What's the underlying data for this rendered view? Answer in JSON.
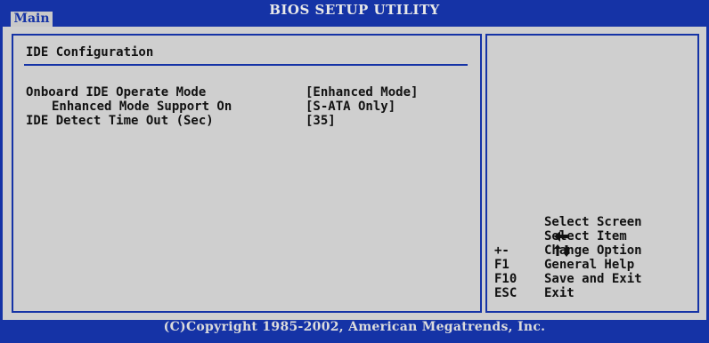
{
  "header": {
    "title": "BIOS SETUP UTILITY",
    "active_tab": "Main"
  },
  "section": {
    "title": "IDE Configuration"
  },
  "settings": [
    {
      "label": "Onboard IDE Operate Mode",
      "value": "[Enhanced Mode]"
    },
    {
      "label": "Enhanced Mode Support On",
      "value": "[S-ATA Only]"
    },
    {
      "label": "IDE Detect Time Out (Sec)",
      "value": "[35]"
    }
  ],
  "help": [
    {
      "key_icon": "arrow-left-icon",
      "key": "",
      "desc": "Select Screen"
    },
    {
      "key_icon": "arrow-up-down-icon",
      "key": "",
      "desc": "Select Item"
    },
    {
      "key": "+-",
      "desc": "Change Option"
    },
    {
      "key": "F1",
      "desc": "General Help"
    },
    {
      "key": "F10",
      "desc": "Save and Exit"
    },
    {
      "key": "ESC",
      "desc": "Exit"
    }
  ],
  "footer": {
    "copyright": "(C)Copyright 1985-2002, American Megatrends, Inc."
  },
  "colors": {
    "background": "#1533a6",
    "panel": "#cfcfcf",
    "text": "#111111"
  }
}
